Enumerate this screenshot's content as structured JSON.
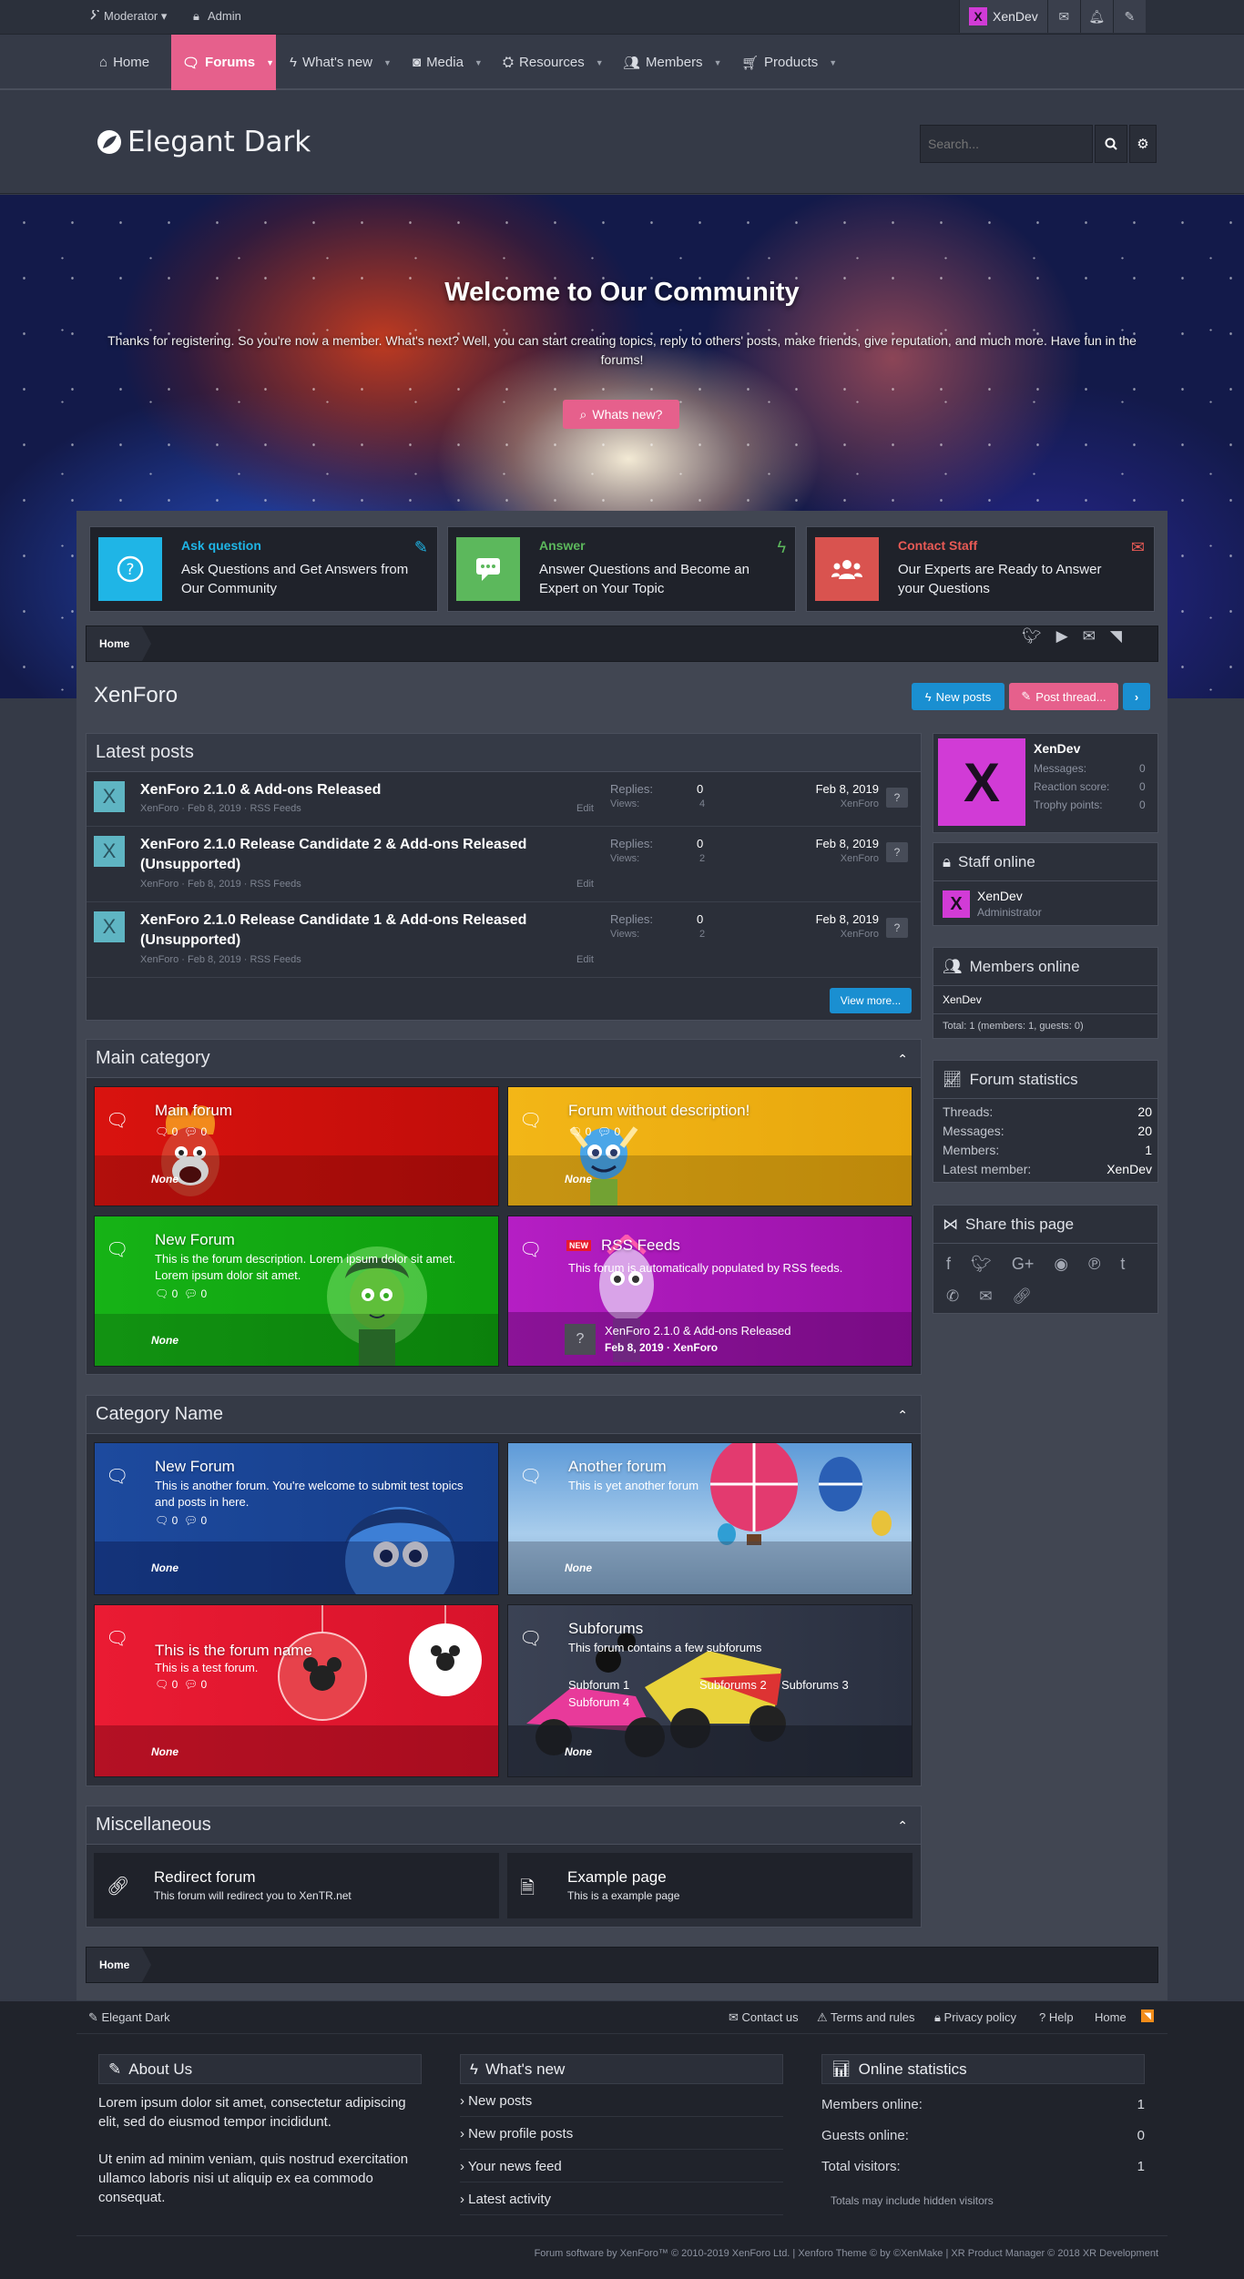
{
  "topbar": {
    "moderator": "Moderator",
    "admin": "Admin",
    "username": "XenDev",
    "avatar_letter": "X"
  },
  "nav": {
    "items": [
      "Home",
      "Forums",
      "What's new",
      "Media",
      "Resources",
      "Members",
      "Products"
    ],
    "active": "Forums"
  },
  "header": {
    "logo": "Elegant Dark",
    "search_placeholder": "Search..."
  },
  "hero": {
    "title": "Welcome to Our Community",
    "text": "Thanks for registering. So you're now a member. What's next? Well, you can start creating topics, reply to others' posts, make friends, give reputation, and much more. Have fun in the forums!",
    "button": "Whats new?"
  },
  "features": [
    {
      "title": "Ask question",
      "desc": "Ask Questions and Get Answers from Our Community",
      "color": "#1fb5e6"
    },
    {
      "title": "Answer",
      "desc": "Answer Questions and Become an Expert on Your Topic",
      "color": "#5cb85c"
    },
    {
      "title": "Contact Staff",
      "desc": "Our Experts are Ready to Answer your Questions",
      "color": "#d9534f"
    }
  ],
  "breadcrumb": {
    "home": "Home"
  },
  "page": {
    "title": "XenForo",
    "new_posts": "New posts",
    "post_thread": "Post thread..."
  },
  "latest": {
    "title": "Latest posts",
    "replies_label": "Replies:",
    "views_label": "Views:",
    "edit_label": "Edit",
    "view_more": "View more...",
    "posts": [
      {
        "title": "XenForo 2.1.0 & Add-ons Released",
        "author": "XenForo",
        "date": "Feb 8, 2019",
        "forum": "RSS Feeds",
        "replies": "0",
        "views": "4",
        "last_date": "Feb 8, 2019",
        "last_user": "XenForo"
      },
      {
        "title": "XenForo 2.1.0 Release Candidate 2 & Add-ons Released (Unsupported)",
        "author": "XenForo",
        "date": "Feb 8, 2019",
        "forum": "RSS Feeds",
        "replies": "0",
        "views": "2",
        "last_date": "Feb 8, 2019",
        "last_user": "XenForo"
      },
      {
        "title": "XenForo 2.1.0 Release Candidate 1 & Add-ons Released (Unsupported)",
        "author": "XenForo",
        "date": "Feb 8, 2019",
        "forum": "RSS Feeds",
        "replies": "0",
        "views": "2",
        "last_date": "Feb 8, 2019",
        "last_user": "XenForo"
      }
    ]
  },
  "main_category": {
    "title": "Main category",
    "forums": [
      {
        "name": "Main forum",
        "desc": "",
        "threads": "0",
        "messages": "0",
        "last": "None"
      },
      {
        "name": "Forum without description!",
        "desc": "",
        "threads": "0",
        "messages": "0",
        "last": "None"
      },
      {
        "name": "New Forum",
        "desc": "This is the forum description. Lorem ipsum dolor sit amet. Lorem ipsum dolor sit amet.",
        "threads": "0",
        "messages": "0",
        "last": "None"
      },
      {
        "name": "RSS Feeds",
        "desc": "This forum is automatically populated by RSS feeds.",
        "badge": "NEW",
        "last_title": "XenForo 2.1.0 & Add-ons Released",
        "last_meta": "Feb 8, 2019 · XenForo"
      }
    ]
  },
  "category_name": {
    "title": "Category Name",
    "forums": [
      {
        "name": "New Forum",
        "desc": "This is another forum. You're welcome to submit test topics and posts in here.",
        "threads": "0",
        "messages": "0",
        "last": "None"
      },
      {
        "name": "Another forum",
        "desc": "This is yet another forum",
        "last": "None"
      },
      {
        "name": "This is the forum name",
        "desc": "This is a test forum.",
        "threads": "0",
        "messages": "0",
        "last": "None"
      },
      {
        "name": "Subforums",
        "desc": "This forum contains a few subforums",
        "subs": [
          "Subforum 1",
          "Subforums 2",
          "Subforums 3",
          "Subforum 4"
        ],
        "last": "None"
      }
    ]
  },
  "misc": {
    "title": "Miscellaneous",
    "items": [
      {
        "name": "Redirect forum",
        "desc": "This forum will redirect you to XenTR.net"
      },
      {
        "name": "Example page",
        "desc": "This is a example page"
      }
    ]
  },
  "sidebar": {
    "user": {
      "name": "XenDev",
      "messages_label": "Messages:",
      "messages": "0",
      "reaction_label": "Reaction score:",
      "reaction": "0",
      "trophy_label": "Trophy points:",
      "trophy": "0"
    },
    "staff": {
      "title": "Staff online",
      "name": "XenDev",
      "role": "Administrator"
    },
    "members": {
      "title": "Members online",
      "name": "XenDev",
      "total": "Total: 1 (members: 1, guests: 0)"
    },
    "stats": {
      "title": "Forum statistics",
      "threads_label": "Threads:",
      "threads": "20",
      "messages_label": "Messages:",
      "messages": "20",
      "members_label": "Members:",
      "members": "1",
      "latest_label": "Latest member:",
      "latest": "XenDev"
    },
    "share": {
      "title": "Share this page"
    }
  },
  "footer": {
    "style": "Elegant Dark",
    "links": [
      "Contact us",
      "Terms and rules",
      "Privacy policy",
      "Help",
      "Home"
    ],
    "about_title": "About Us",
    "about_p1": "Lorem ipsum dolor sit amet, consectetur adipiscing elit, sed do eiusmod tempor incididunt.",
    "about_p2": "Ut enim ad minim veniam, quis nostrud exercitation ullamco laboris nisi ut aliquip ex ea commodo consequat.",
    "whatsnew_title": "What's new",
    "whatsnew_links": [
      "New posts",
      "New profile posts",
      "Your news feed",
      "Latest activity"
    ],
    "online_title": "Online statistics",
    "members_online_label": "Members online:",
    "members_online": "1",
    "guests_online_label": "Guests online:",
    "guests_online": "0",
    "total_visitors_label": "Total visitors:",
    "total_visitors": "1",
    "hidden_note": "Totals may include hidden visitors",
    "copyright": "Forum software by XenForo™ © 2010-2019 XenForo Ltd. | Xenforo Theme © by ©XenMake | XR Product Manager © 2018 XR Development"
  },
  "colors": {
    "accent": "#e6608c",
    "blue": "#1a8fd1",
    "bg": "#353a47"
  }
}
